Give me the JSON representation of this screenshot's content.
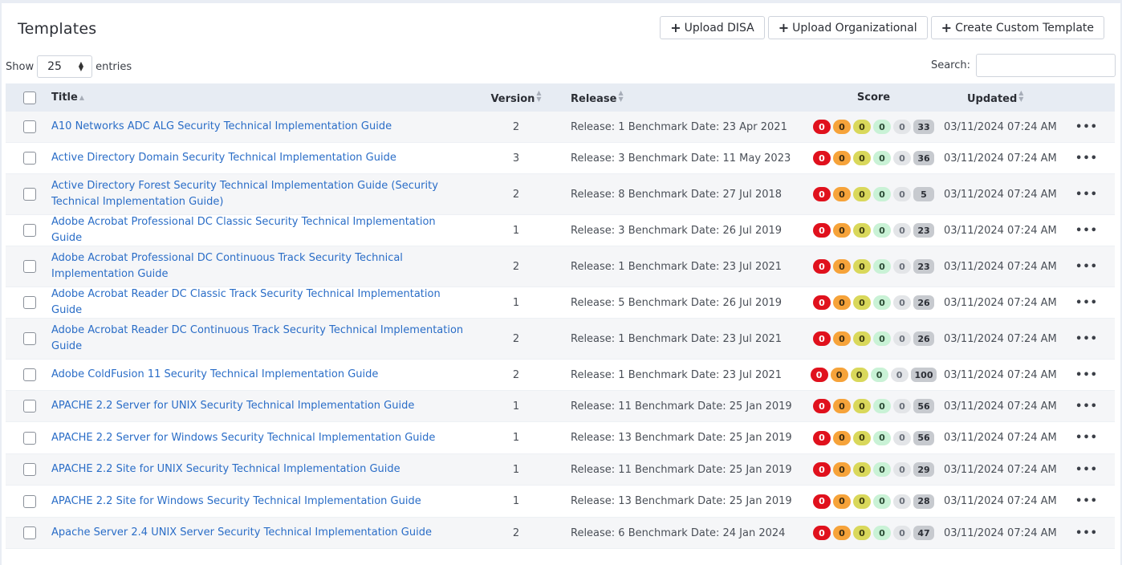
{
  "page": {
    "title": "Templates",
    "buttons": {
      "upload_disa": "Upload DISA",
      "upload_org": "Upload Organizational",
      "create_custom": "Create Custom Template"
    },
    "length": {
      "show_label": "Show",
      "value": "25",
      "entries_label": "entries"
    },
    "search": {
      "label": "Search:",
      "value": ""
    }
  },
  "table": {
    "headers": {
      "title": "Title",
      "version": "Version",
      "release": "Release",
      "score": "Score",
      "updated": "Updated"
    },
    "rows": [
      {
        "title": "A10 Networks ADC ALG Security Technical Implementation Guide",
        "version": "2",
        "release": "Release: 1 Benchmark Date: 23 Apr 2021",
        "score": [
          "0",
          "0",
          "0",
          "0",
          "0",
          "33"
        ],
        "updated": "03/11/2024 07:24 AM"
      },
      {
        "title": "Active Directory Domain Security Technical Implementation Guide",
        "version": "3",
        "release": "Release: 3 Benchmark Date: 11 May 2023",
        "score": [
          "0",
          "0",
          "0",
          "0",
          "0",
          "36"
        ],
        "updated": "03/11/2024 07:24 AM"
      },
      {
        "title": "Active Directory Forest Security Technical Implementation Guide (Security Technical Implementation Guide)",
        "version": "2",
        "release": "Release: 8 Benchmark Date: 27 Jul 2018",
        "score": [
          "0",
          "0",
          "0",
          "0",
          "0",
          "5"
        ],
        "updated": "03/11/2024 07:24 AM"
      },
      {
        "title": "Adobe Acrobat Professional DC Classic Security Technical Implementation Guide",
        "version": "1",
        "release": "Release: 3 Benchmark Date: 26 Jul 2019",
        "score": [
          "0",
          "0",
          "0",
          "0",
          "0",
          "23"
        ],
        "updated": "03/11/2024 07:24 AM"
      },
      {
        "title": "Adobe Acrobat Professional DC Continuous Track Security Technical Implementation Guide",
        "version": "2",
        "release": "Release: 1 Benchmark Date: 23 Jul 2021",
        "score": [
          "0",
          "0",
          "0",
          "0",
          "0",
          "23"
        ],
        "updated": "03/11/2024 07:24 AM"
      },
      {
        "title": "Adobe Acrobat Reader DC Classic Track Security Technical Implementation Guide",
        "version": "1",
        "release": "Release: 5 Benchmark Date: 26 Jul 2019",
        "score": [
          "0",
          "0",
          "0",
          "0",
          "0",
          "26"
        ],
        "updated": "03/11/2024 07:24 AM"
      },
      {
        "title": "Adobe Acrobat Reader DC Continuous Track Security Technical Implementation Guide",
        "version": "2",
        "release": "Release: 1 Benchmark Date: 23 Jul 2021",
        "score": [
          "0",
          "0",
          "0",
          "0",
          "0",
          "26"
        ],
        "updated": "03/11/2024 07:24 AM"
      },
      {
        "title": "Adobe ColdFusion 11 Security Technical Implementation Guide",
        "version": "2",
        "release": "Release: 1 Benchmark Date: 23 Jul 2021",
        "score": [
          "0",
          "0",
          "0",
          "0",
          "0",
          "100"
        ],
        "updated": "03/11/2024 07:24 AM"
      },
      {
        "title": "APACHE 2.2 Server for UNIX Security Technical Implementation Guide",
        "version": "1",
        "release": "Release: 11 Benchmark Date: 25 Jan 2019",
        "score": [
          "0",
          "0",
          "0",
          "0",
          "0",
          "56"
        ],
        "updated": "03/11/2024 07:24 AM"
      },
      {
        "title": "APACHE 2.2 Server for Windows Security Technical Implementation Guide",
        "version": "1",
        "release": "Release: 13 Benchmark Date: 25 Jan 2019",
        "score": [
          "0",
          "0",
          "0",
          "0",
          "0",
          "56"
        ],
        "updated": "03/11/2024 07:24 AM"
      },
      {
        "title": "APACHE 2.2 Site for UNIX Security Technical Implementation Guide",
        "version": "1",
        "release": "Release: 11 Benchmark Date: 25 Jan 2019",
        "score": [
          "0",
          "0",
          "0",
          "0",
          "0",
          "29"
        ],
        "updated": "03/11/2024 07:24 AM"
      },
      {
        "title": "APACHE 2.2 Site for Windows Security Technical Implementation Guide",
        "version": "1",
        "release": "Release: 13 Benchmark Date: 25 Jan 2019",
        "score": [
          "0",
          "0",
          "0",
          "0",
          "0",
          "28"
        ],
        "updated": "03/11/2024 07:24 AM"
      },
      {
        "title": "Apache Server 2.4 UNIX Server Security Technical Implementation Guide",
        "version": "2",
        "release": "Release: 6 Benchmark Date: 24 Jan 2024",
        "score": [
          "0",
          "0",
          "0",
          "0",
          "0",
          "47"
        ],
        "updated": "03/11/2024 07:24 AM"
      }
    ],
    "score_colors": [
      "#e0111d",
      "#f6a33a",
      "#d9d85b",
      "#c9f2d6",
      "#e3e5e8",
      "#c7cacf"
    ],
    "actions_icon": "more-horizontal-icon"
  }
}
